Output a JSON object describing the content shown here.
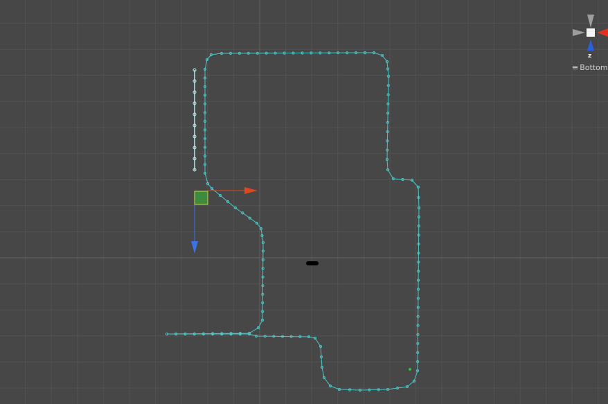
{
  "view": {
    "orientation_label": "Bottom",
    "axis_label": "z",
    "menu_icon": "hamburger-menu-icon",
    "background_color": "#474747",
    "grid_color": "#525252",
    "path_color": "#4cc6c6"
  },
  "gizmo": {
    "x_axis_color": "#e2311f",
    "y_axis_color": "#9a9a9a",
    "z_axis_color": "#2a5fe0"
  },
  "transform_handle": {
    "x_axis_color": "#e0461e",
    "z_axis_color": "#3b73e6",
    "plane_color": "#3e8a3e"
  }
}
